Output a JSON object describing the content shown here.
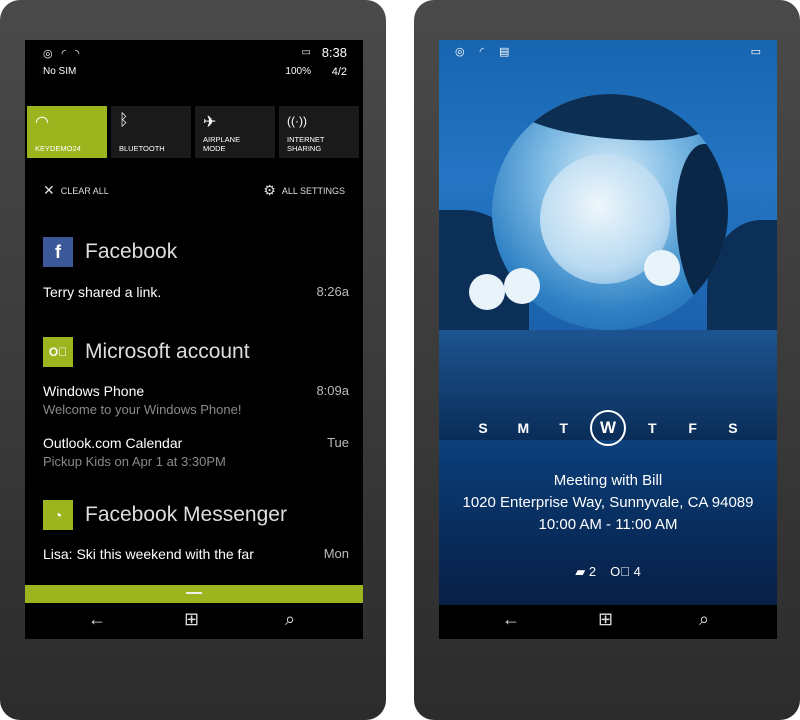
{
  "left_phone": {
    "status": {
      "icons": "◎ ◜ ◝",
      "carrier": "No SIM",
      "battery_icon": "▭",
      "battery_pct": "100%",
      "time": "8:38",
      "date": "4/2"
    },
    "quick_actions": [
      {
        "icon": "wifi-icon",
        "glyph": "◠",
        "label": "KEYDEMO24",
        "active": true
      },
      {
        "icon": "bluetooth-icon",
        "glyph": "ᛒ",
        "label": "BLUETOOTH",
        "active": false
      },
      {
        "icon": "airplane-icon",
        "glyph": "✈",
        "label": "AIRPLANE MODE",
        "active": false
      },
      {
        "icon": "internet-sharing-icon",
        "glyph": "((·))",
        "label": "INTERNET SHARING",
        "active": false
      }
    ],
    "clear_all": "CLEAR ALL",
    "all_settings": "ALL SETTINGS",
    "notifications": {
      "facebook": {
        "app": "Facebook",
        "items": [
          {
            "title": "Terry shared a link.",
            "subtitle": "",
            "time": "8:26a"
          }
        ]
      },
      "microsoft": {
        "app": "Microsoft account",
        "items": [
          {
            "title": "Windows Phone",
            "subtitle": "Welcome to your Windows Phone!",
            "time": "8:09a"
          },
          {
            "title": "Outlook.com Calendar",
            "subtitle": "Pickup Kids on Apr 1 at 3:30PM",
            "time": "Tue"
          }
        ]
      },
      "messenger": {
        "app": "Facebook Messenger",
        "items": [
          {
            "title": "Lisa: Ski this weekend with the far",
            "subtitle": "",
            "time": "Mon"
          }
        ]
      }
    },
    "nav": {
      "back": "←",
      "home": "⊞",
      "search": "⌕"
    }
  },
  "right_phone": {
    "status_left": "◎ ◜ ▤",
    "status_right": "▭",
    "week_days": [
      "S",
      "M",
      "T",
      "W",
      "T",
      "F",
      "S"
    ],
    "today_index": 3,
    "event": {
      "title": "Meeting with Bill",
      "location": "1020 Enterprise Way, Sunnyvale, CA 94089",
      "time": "10:00 AM - 11:00 AM"
    },
    "counts": {
      "messages": "2",
      "outlook": "4"
    },
    "nav": {
      "back": "←",
      "home": "⊞",
      "search": "⌕"
    }
  },
  "colors": {
    "accent": "#9cb41e",
    "facebook": "#3b5998"
  }
}
